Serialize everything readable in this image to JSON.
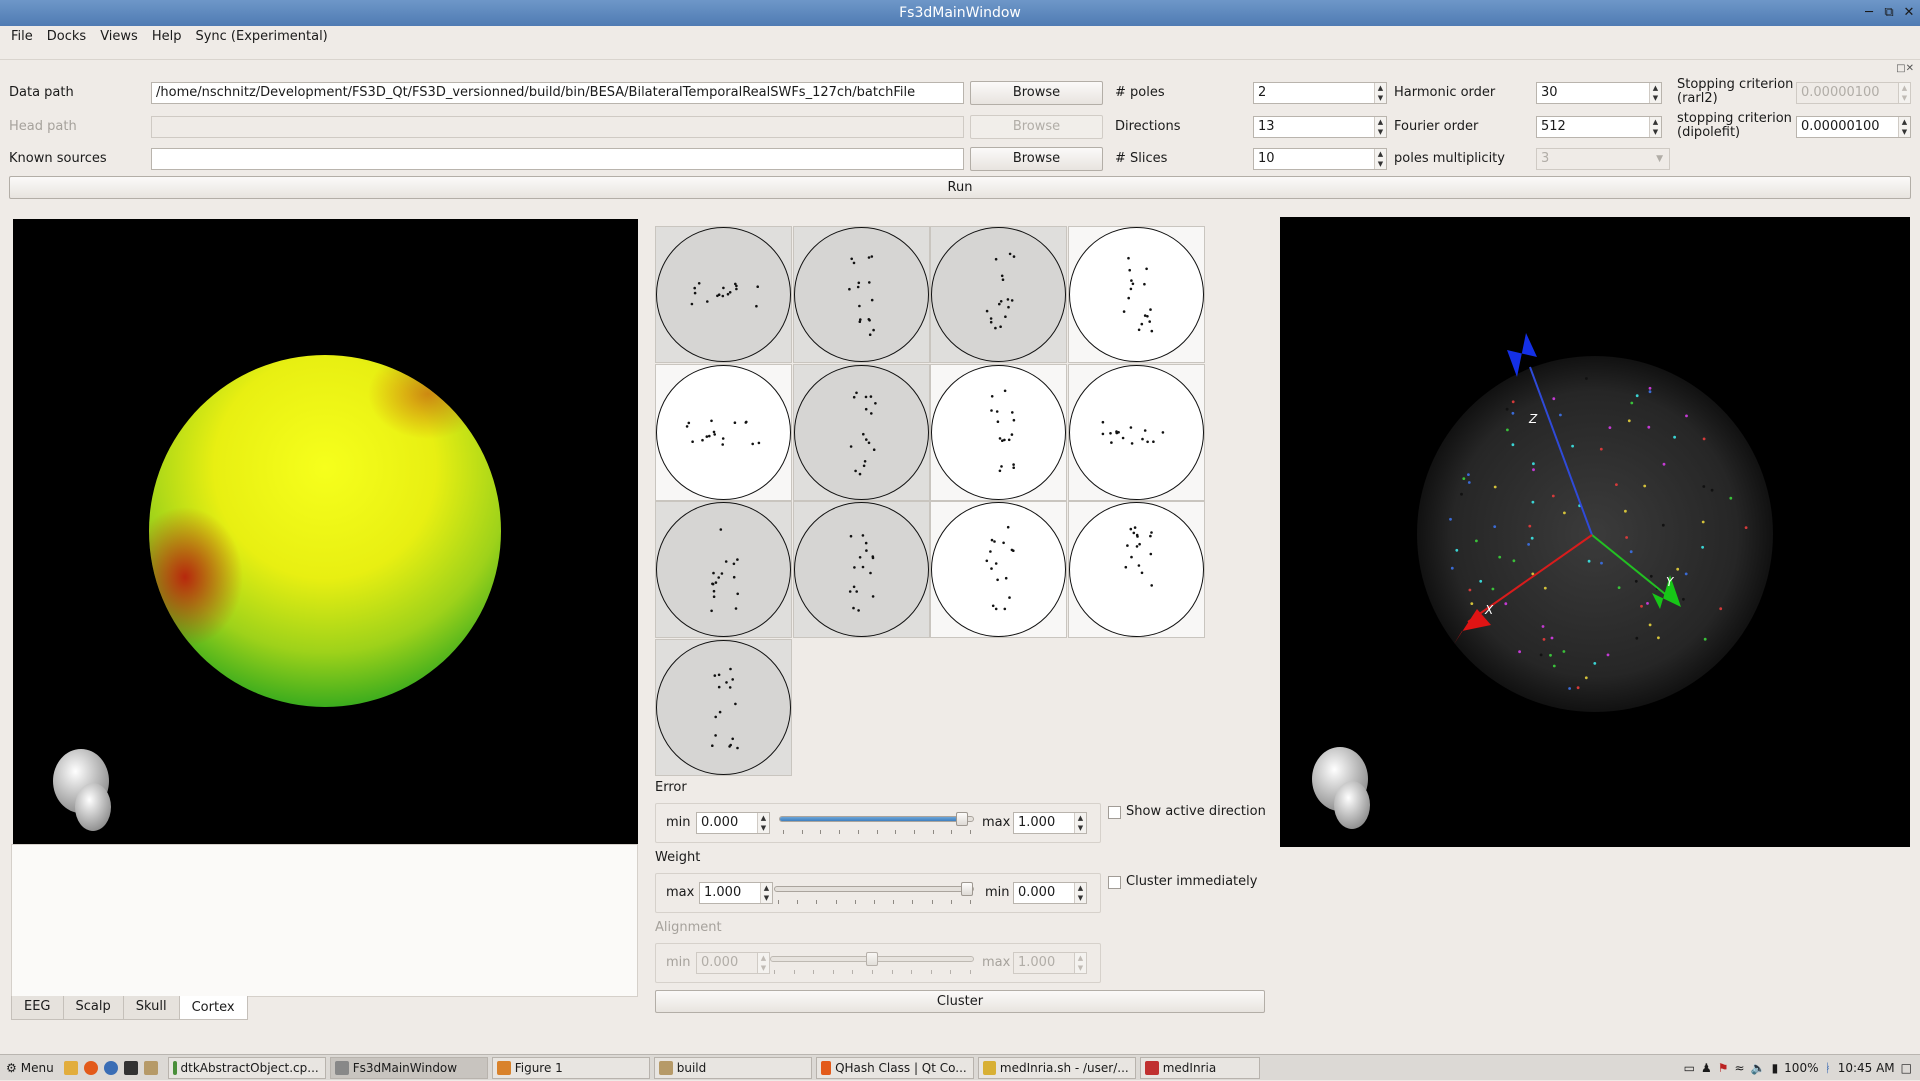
{
  "window": {
    "title": "Fs3dMainWindow"
  },
  "menu": [
    "File",
    "Docks",
    "Views",
    "Help",
    "Sync (Experimental)"
  ],
  "form": {
    "data_path_label": "Data path",
    "data_path_value": "/home/nschnitz/Development/FS3D_Qt/FS3D_versionned/build/bin/BESA/BilateralTemporalRealSWFs_127ch/batchFile",
    "head_path_label": "Head path",
    "head_path_value": "",
    "known_sources_label": "Known sources",
    "known_sources_value": "",
    "browse": "Browse",
    "poles_label": "# poles",
    "poles_value": "2",
    "directions_label": "Directions",
    "directions_value": "13",
    "slices_label": "# Slices",
    "slices_value": "10",
    "harmonic_label": "Harmonic order",
    "harmonic_value": "30",
    "fourier_label": "Fourier order",
    "fourier_value": "512",
    "multiplicity_label": "poles multiplicity",
    "multiplicity_value": "3",
    "stop_rarl2_label_1": "Stopping criterion",
    "stop_rarl2_label_2": "(rarl2)",
    "stop_rarl2_value": "0.00000100",
    "stop_dipole_label_1": "stopping criterion",
    "stop_dipole_label_2": "(dipolefit)",
    "stop_dipole_value": "0.00000100",
    "run": "Run"
  },
  "left_view": {
    "tabs": [
      "EEG",
      "Scalp",
      "Skull",
      "Cortex"
    ],
    "active_tab": "Cortex"
  },
  "right_view": {
    "axis_labels": [
      "Z",
      "Y",
      "X"
    ]
  },
  "clustering": {
    "error_label": "Error",
    "error_min_label": "min",
    "error_min": "0.000",
    "error_max_label": "max",
    "error_max": "1.000",
    "error_slider_level": 0.97,
    "show_active_direction": "Show active direction",
    "weight_label": "Weight",
    "weight_max_label": "max",
    "weight_max": "1.000",
    "weight_min_label": "min",
    "weight_min": "0.000",
    "weight_slider_level": 1.0,
    "cluster_immediately": "Cluster immediately",
    "alignment_label": "Alignment",
    "alignment_min_label": "min",
    "alignment_min": "0.000",
    "alignment_max_label": "max",
    "alignment_max": "1.000",
    "alignment_slider_level": 0.5,
    "cluster": "Cluster"
  },
  "taskbar": {
    "menu": "Menu",
    "items": [
      "dtkAbstractObject.cp...",
      "Fs3dMainWindow",
      "Figure 1",
      "build",
      "QHash Class | Qt Co...",
      "medInria.sh - /user/...",
      "medInria"
    ],
    "battery": "100%",
    "clock": "10:45 AM"
  },
  "colors": {
    "titlebar": "#4f7bb3",
    "slider_fill": "#3f7fbe",
    "background": "#efebe7"
  }
}
